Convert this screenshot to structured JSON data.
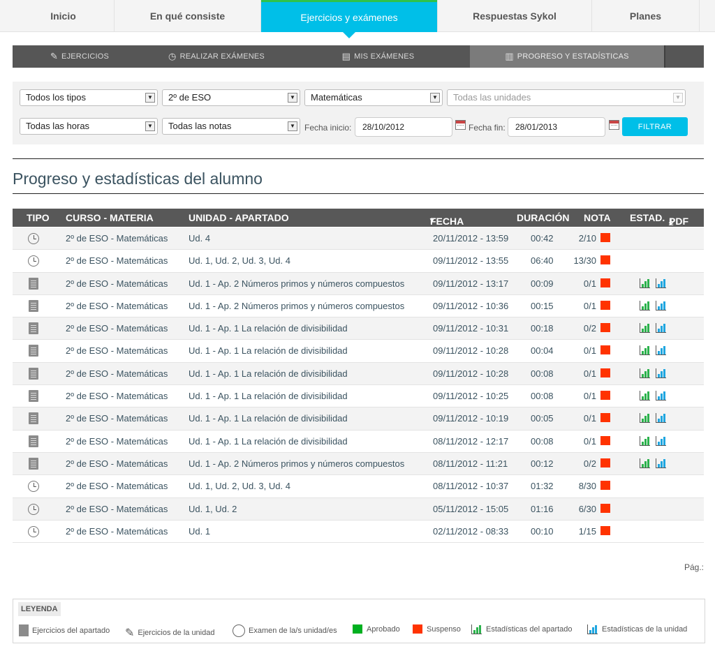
{
  "top_nav": {
    "tabs": [
      {
        "label": "Inicio"
      },
      {
        "label": "En qué consiste"
      },
      {
        "label": "Ejercicios y exámenes"
      },
      {
        "label": "Respuestas Sykol"
      },
      {
        "label": "Planes"
      }
    ],
    "active_index": 2
  },
  "sub_nav": {
    "tabs": [
      {
        "label": "Ejercicios",
        "icon": "pencil-icon"
      },
      {
        "label": "Realizar exámenes",
        "icon": "clock-icon"
      },
      {
        "label": "Mis exámenes",
        "icon": "document-icon"
      },
      {
        "label": "Progreso y estadísticas",
        "icon": "chart-icon"
      }
    ],
    "active_index": 3
  },
  "filters": {
    "tipo": "Todos los tipos",
    "curso": "2º de ESO",
    "materia": "Matemáticas",
    "unidades": "Todas las unidades",
    "horas": "Todas las horas",
    "notas": "Todas las notas",
    "fecha_inicio_label": "Fecha inicio:",
    "fecha_inicio": "28/10/2012",
    "fecha_fin_label": "Fecha fin:",
    "fecha_fin": "28/01/2013",
    "filter_button": "FILTRAR"
  },
  "page_title": "Progreso y estadísticas del alumno",
  "table": {
    "headers": {
      "tipo": "TIPO",
      "curso": "CURSO - MATERIA",
      "unidad": "UNIDAD - APARTADO",
      "fecha": "FECHA - HORA",
      "duracion": "DURACIÓN",
      "nota": "NOTA",
      "estad": "ESTAD.",
      "pdf": "PDF"
    },
    "sort_indicator": "▾",
    "rows": [
      {
        "tipo": "exam",
        "curso": "2º de ESO - Matemáticas",
        "unidad": "Ud. 4",
        "fecha": "20/11/2012 - 13:59",
        "duracion": "00:42",
        "nota": "2/10",
        "stats": false
      },
      {
        "tipo": "exam",
        "curso": "2º de ESO - Matemáticas",
        "unidad": "Ud. 1, Ud. 2, Ud. 3, Ud. 4",
        "fecha": "09/11/2012 - 13:55",
        "duracion": "06:40",
        "nota": "13/30",
        "stats": false
      },
      {
        "tipo": "apartado",
        "curso": "2º de ESO - Matemáticas",
        "unidad": "Ud. 1 - Ap. 2 Números primos y números compuestos",
        "fecha": "09/11/2012 - 13:17",
        "duracion": "00:09",
        "nota": "0/1",
        "stats": true
      },
      {
        "tipo": "apartado",
        "curso": "2º de ESO - Matemáticas",
        "unidad": "Ud. 1 - Ap. 2 Números primos y números compuestos",
        "fecha": "09/11/2012 - 10:36",
        "duracion": "00:15",
        "nota": "0/1",
        "stats": true
      },
      {
        "tipo": "apartado",
        "curso": "2º de ESO - Matemáticas",
        "unidad": "Ud. 1 - Ap. 1 La relación de divisibilidad",
        "fecha": "09/11/2012 - 10:31",
        "duracion": "00:18",
        "nota": "0/2",
        "stats": true
      },
      {
        "tipo": "apartado",
        "curso": "2º de ESO - Matemáticas",
        "unidad": "Ud. 1 - Ap. 1 La relación de divisibilidad",
        "fecha": "09/11/2012 - 10:28",
        "duracion": "00:04",
        "nota": "0/1",
        "stats": true
      },
      {
        "tipo": "apartado",
        "curso": "2º de ESO - Matemáticas",
        "unidad": "Ud. 1 - Ap. 1 La relación de divisibilidad",
        "fecha": "09/11/2012 - 10:28",
        "duracion": "00:08",
        "nota": "0/1",
        "stats": true
      },
      {
        "tipo": "apartado",
        "curso": "2º de ESO - Matemáticas",
        "unidad": "Ud. 1 - Ap. 1 La relación de divisibilidad",
        "fecha": "09/11/2012 - 10:25",
        "duracion": "00:08",
        "nota": "0/1",
        "stats": true
      },
      {
        "tipo": "apartado",
        "curso": "2º de ESO - Matemáticas",
        "unidad": "Ud. 1 - Ap. 1 La relación de divisibilidad",
        "fecha": "09/11/2012 - 10:19",
        "duracion": "00:05",
        "nota": "0/1",
        "stats": true
      },
      {
        "tipo": "apartado",
        "curso": "2º de ESO - Matemáticas",
        "unidad": "Ud. 1 - Ap. 1 La relación de divisibilidad",
        "fecha": "08/11/2012 - 12:17",
        "duracion": "00:08",
        "nota": "0/1",
        "stats": true
      },
      {
        "tipo": "apartado",
        "curso": "2º de ESO - Matemáticas",
        "unidad": "Ud. 1 - Ap. 2 Números primos y números compuestos",
        "fecha": "08/11/2012 - 11:21",
        "duracion": "00:12",
        "nota": "0/2",
        "stats": true
      },
      {
        "tipo": "exam",
        "curso": "2º de ESO - Matemáticas",
        "unidad": "Ud. 1, Ud. 2, Ud. 3, Ud. 4",
        "fecha": "08/11/2012 - 10:37",
        "duracion": "01:32",
        "nota": "8/30",
        "stats": false
      },
      {
        "tipo": "exam",
        "curso": "2º de ESO - Matemáticas",
        "unidad": "Ud. 1, Ud. 2",
        "fecha": "05/11/2012 - 15:05",
        "duracion": "01:16",
        "nota": "6/30",
        "stats": false
      },
      {
        "tipo": "exam",
        "curso": "2º de ESO - Matemáticas",
        "unidad": "Ud. 1",
        "fecha": "02/11/2012 - 08:33",
        "duracion": "00:10",
        "nota": "1/15",
        "stats": false
      }
    ]
  },
  "pagination_label": "Pág.:",
  "legend": {
    "title": "LEYENDA",
    "items": [
      {
        "label": "Ejercicios del apartado",
        "icon": "document-icon"
      },
      {
        "label": "Ejercicios de la unidad",
        "icon": "pencil-icon"
      },
      {
        "label": "Examen de la/s unidad/es",
        "icon": "clock-icon"
      },
      {
        "label": "Aprobado",
        "icon": "green-square-icon"
      },
      {
        "label": "Suspenso",
        "icon": "red-square-icon"
      },
      {
        "label": "Estadísticas del apartado",
        "icon": "green-chart-icon"
      },
      {
        "label": "Estadísticas de la unidad",
        "icon": "blue-chart-icon"
      }
    ]
  },
  "colors": {
    "accent": "#00bfe8",
    "approved": "#00b020",
    "failed": "#ff3300",
    "header_dark": "#585858"
  }
}
